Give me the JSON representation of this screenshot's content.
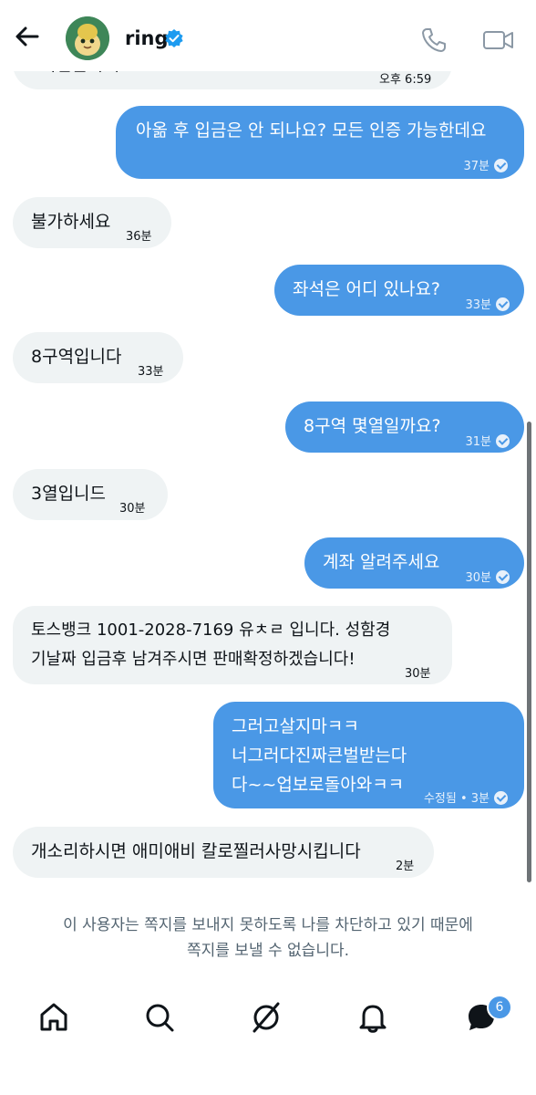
{
  "header": {
    "title": "ring"
  },
  "messages": [
    {
      "text": [
        "이입금하기."
      ],
      "meta": "오후 6:59",
      "check": false
    },
    {
      "text": [
        "아옮 후 입금은 안 되나요? 모든 인증 가능한데요"
      ],
      "meta": "37분",
      "check": true
    },
    {
      "text": [
        "불가하세요"
      ],
      "meta": "36분",
      "check": false
    },
    {
      "text": [
        "좌석은 어디 있나요?"
      ],
      "meta": "33분",
      "check": true
    },
    {
      "text": [
        "8구역입니다"
      ],
      "meta": "33분",
      "check": false
    },
    {
      "text": [
        "8구역 몇열일까요?"
      ],
      "meta": "31분",
      "check": true
    },
    {
      "text": [
        "3열입니드"
      ],
      "meta": "30분",
      "check": false
    },
    {
      "text": [
        "계좌 알려주세요"
      ],
      "meta": "30분",
      "check": true
    },
    {
      "text": [
        "토스뱅크 1001-2028-7169 유ㅊㄹ 입니다. 성함경",
        "기날짜 입금후 남겨주시면 판매확정하겠습니다!"
      ],
      "meta": "30분",
      "check": false
    },
    {
      "text": [
        "그러고살지마ㅋㅋ",
        "너그러다진짜큰벌받는다",
        "다~~업보로돌아와ㅋㅋ"
      ],
      "meta": "수정됨 • 3분",
      "check": true
    },
    {
      "text": [
        "개소리하시면 애미애비 칼로찔러사망시킵니다"
      ],
      "meta": "2분",
      "check": false
    }
  ],
  "blocked_notice": [
    "이 사용자는 쪽지를 보내지 못하도록 나를 차단하고 있기 때문에",
    "쪽지를 보낼 수 없습니다."
  ],
  "nav": {
    "messages_badge": "6"
  },
  "icons": [
    "back-arrow-icon",
    "verified-badge-icon",
    "phone-icon",
    "video-camera-icon",
    "home-icon",
    "search-icon",
    "grok-icon",
    "bell-icon",
    "messages-icon"
  ],
  "colors": {
    "outgoing_bubble": "#4a98e6",
    "incoming_bubble": "#eff3f4",
    "accent": "#1d9bf0"
  }
}
